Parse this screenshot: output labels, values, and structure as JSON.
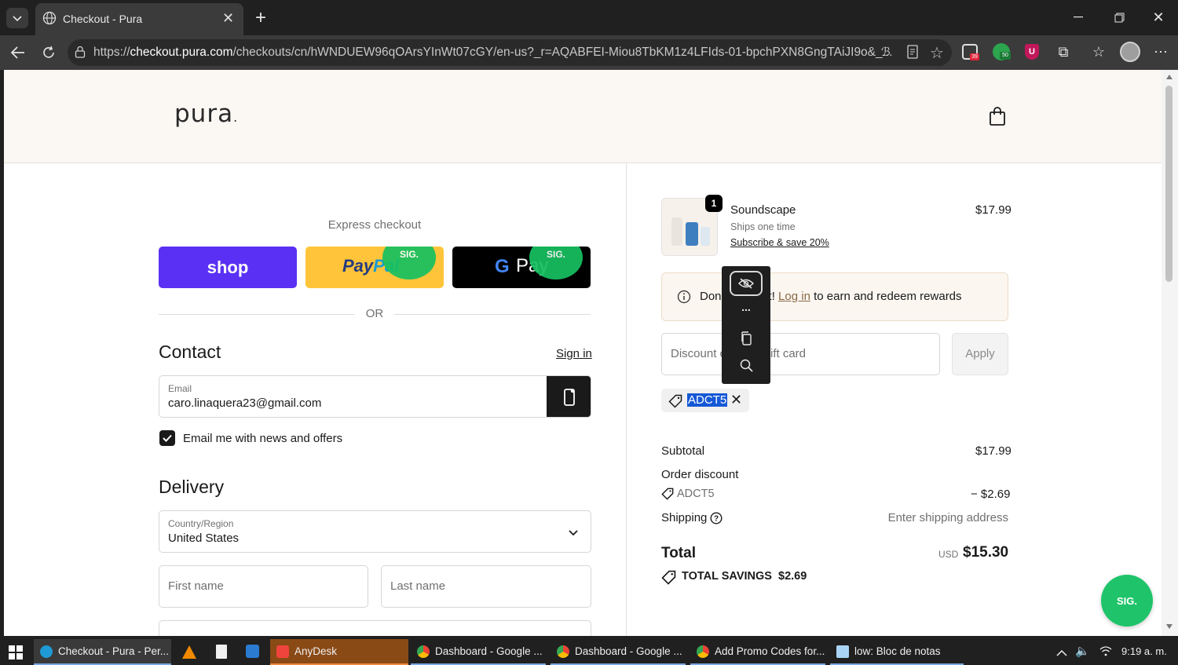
{
  "browser": {
    "tab_title": "Checkout - Pura",
    "url_prefix": "https://",
    "url_host": "checkout.pura.com",
    "url_rest": "/checkouts/cn/hWNDUEW96qOArsYInWt07cGY/en-us?_r=AQABFEI-Miou8TbKM1z4LFIds-01-bpchPXN8GngTAiJI9o&_..."
  },
  "header": {
    "logo": "pura",
    "logo_dot": "."
  },
  "express": {
    "title": "Express checkout",
    "shop_label": "shop",
    "paypal_label_a": "Pay",
    "paypal_label_b": "Pal",
    "gpay_label_g": "G",
    "gpay_label": "Pay",
    "sig_label": "SIG.",
    "or_label": "OR"
  },
  "contact": {
    "heading": "Contact",
    "sign_in": "Sign in",
    "email_label": "Email",
    "email_value": "caro.linaquera23@gmail.com",
    "newsletter_label": "Email me with news and offers",
    "newsletter_checked": true
  },
  "delivery": {
    "heading": "Delivery",
    "country_label": "Country/Region",
    "country_value": "United States",
    "first_name_placeholder": "First name",
    "last_name_placeholder": "Last name"
  },
  "cart": {
    "item_name": "Soundscape",
    "item_qty": "1",
    "item_ships": "Ships one time",
    "item_subscribe": "Subscribe & save 20%",
    "item_price": "$17.99",
    "rewards_prefix": "Don",
    "rewards_mid": "t! ",
    "rewards_link": "Log in",
    "rewards_suffix": " to earn and redeem rewards",
    "discount_placeholder_a": "Discount c",
    "discount_placeholder_b": "ift card",
    "apply_label": "Apply",
    "applied_code": "ADCT5",
    "subtotal_label": "Subtotal",
    "subtotal_value": "$17.99",
    "order_discount_label": "Order discount",
    "discount_code": "ADCT5",
    "discount_value": "− $2.69",
    "shipping_label": "Shipping",
    "shipping_value": "Enter shipping address",
    "total_label": "Total",
    "total_currency": "USD",
    "total_value": "$15.30",
    "savings_label": "TOTAL SAVINGS",
    "savings_value": "$2.69"
  },
  "popup_toolbar": {
    "more_label": "..."
  },
  "float_sig": {
    "label": "SIG."
  },
  "taskbar": {
    "items": [
      "Checkout - Pura - Per...",
      "AnyDesk",
      "Dashboard - Google ...",
      "Dashboard - Google ...",
      "Add Promo Codes for...",
      "low: Bloc de notas"
    ],
    "clock": "9:19 a. m."
  },
  "colors": {
    "shop_purple": "#5a31f4",
    "paypal_yellow": "#ffc439",
    "sig_green": "#17c060",
    "header_bg": "#fbf8f4"
  }
}
